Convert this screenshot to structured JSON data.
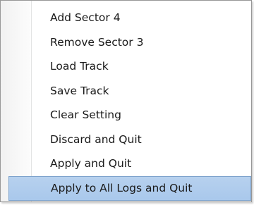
{
  "context_menu": {
    "items": [
      {
        "label": "Add Sector 4",
        "highlighted": false
      },
      {
        "label": "Remove Sector 3",
        "highlighted": false
      },
      {
        "label": "Load Track",
        "highlighted": false
      },
      {
        "label": "Save Track",
        "highlighted": false
      },
      {
        "label": "Clear Setting",
        "highlighted": false
      },
      {
        "label": "Discard and Quit",
        "highlighted": false
      },
      {
        "label": "Apply and Quit",
        "highlighted": false
      },
      {
        "label": "Apply to All Logs and Quit",
        "highlighted": true
      }
    ],
    "colors": {
      "highlight_fill": "#aecbee",
      "highlight_border": "#7ea3cc",
      "menu_border": "#979797",
      "text": "#1a1a1a"
    }
  }
}
